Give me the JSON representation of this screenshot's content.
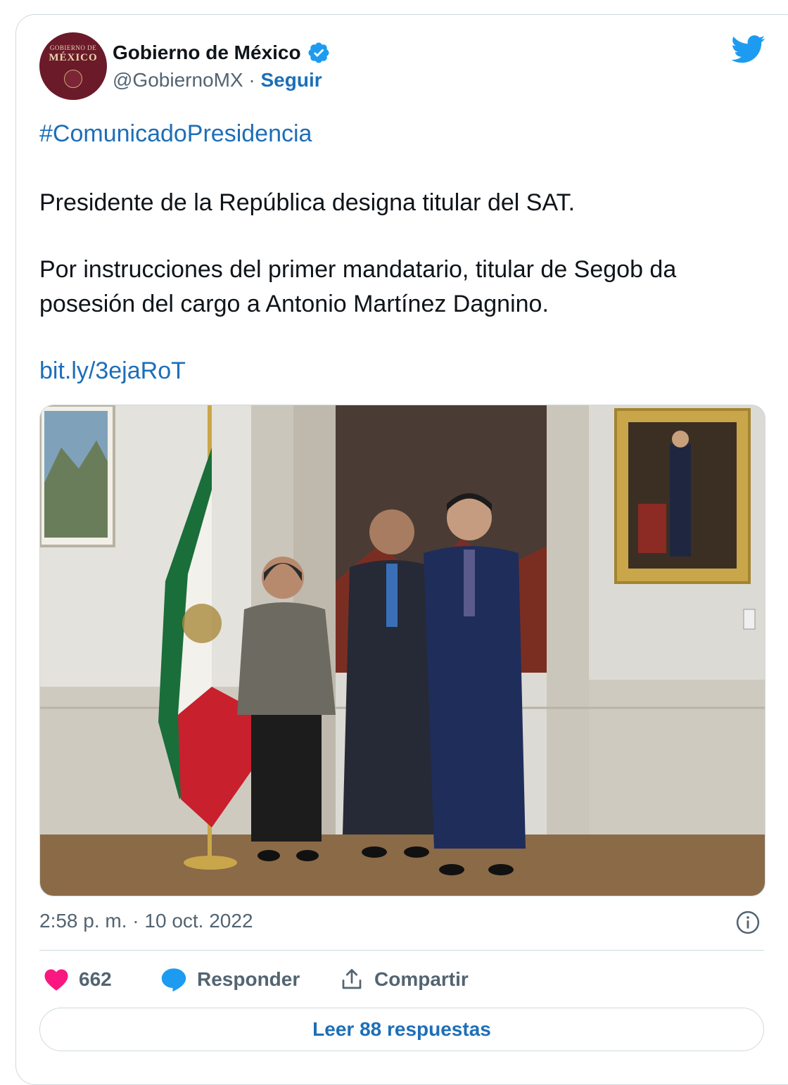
{
  "account": {
    "avatar_line1": "GOBIERNO DE",
    "avatar_line2": "MÉXICO",
    "name": "Gobierno de México",
    "handle": "@GobiernoMX",
    "separator": " · ",
    "follow_label": "Seguir"
  },
  "tweet": {
    "hashtag": "#ComunicadoPresidencia",
    "paragraph1": "Presidente de la República designa titular del SAT.",
    "paragraph2_line1": "Por instrucciones del primer mandatario, titular de Segob da",
    "paragraph2_line2": "posesión del cargo a Antonio Martínez Dagnino.",
    "link": "bit.ly/3ejaRoT"
  },
  "meta": {
    "timestamp": "2:58 p. m. · 10 oct. 2022"
  },
  "actions": {
    "likes_count": "662",
    "reply_label": "Responder",
    "share_label": "Compartir",
    "read_replies_label": "Leer 88 respuestas"
  },
  "colors": {
    "link_blue": "#1d6fb8",
    "verified_blue": "#1d9bf0",
    "heart_pink": "#f91880",
    "avatar_bg": "#6b1a2a"
  },
  "icons": [
    "verified-badge-icon",
    "twitter-bird-icon",
    "info-icon",
    "heart-icon",
    "reply-bubble-icon",
    "share-icon"
  ]
}
